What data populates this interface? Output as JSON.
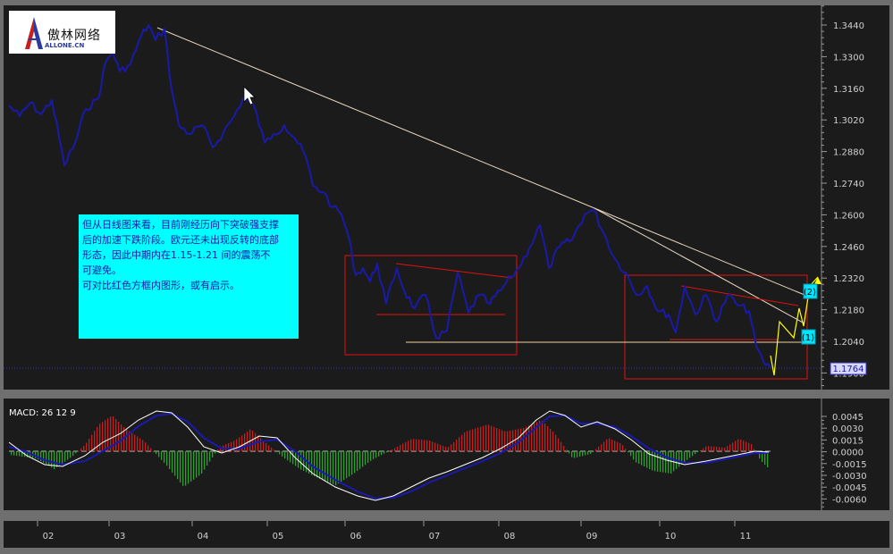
{
  "logo": {
    "name": "傲林网络",
    "domain": "ALLONE.CN"
  },
  "price_panel": {
    "y_ticks": [
      "1.3440",
      "1.3300",
      "1.3160",
      "1.3020",
      "1.2880",
      "1.2740",
      "1.2600",
      "1.2460",
      "1.2320",
      "1.2180",
      "1.2040",
      "1.1900"
    ],
    "last_price_label": "1.1764",
    "wave_labels": [
      "(2)",
      "(1)"
    ]
  },
  "annotation": {
    "lines": [
      "但从日线图来看，目前刚经历向下突破强支撑",
      "后的加速下跌阶段。欧元还未出现反转的底部",
      "形态，因此中期内在1.15-1.21  间的震荡不",
      "可避免。",
      "可对比红色方框内图形，或有启示。"
    ]
  },
  "macd_panel": {
    "label": "MACD: 26 12 9",
    "y_ticks": [
      "0.0045",
      "0.0030",
      "0.0015",
      "0.0000",
      "-0.0015",
      "-0.0030",
      "-0.0045",
      "-0.0060"
    ]
  },
  "x_axis": {
    "labels": [
      "02",
      "03",
      "04",
      "05",
      "06",
      "07",
      "08",
      "09",
      "10",
      "11"
    ]
  },
  "colors": {
    "background": "#1b1b1b",
    "price_line": "#1a1aa8",
    "trendline": "#e8d8c0",
    "box": "#e01010",
    "support": "#f0d0a0",
    "annotation_bg": "#00ffff",
    "projection": "#ffff00",
    "macd_pos": "#c81e1e",
    "macd_neg": "#2fa02f",
    "macd_line": "#ffffff",
    "signal_line": "#1a1ab0"
  },
  "chart_data": [
    {
      "type": "line",
      "title": "",
      "x": [
        "02",
        "03",
        "04",
        "05",
        "06",
        "07",
        "08",
        "09",
        "10",
        "11"
      ],
      "ylim": [
        1.175,
        1.35
      ],
      "series": [
        {
          "values": [
            1.305,
            1.336,
            1.312,
            1.305,
            1.228,
            1.194,
            1.23,
            1.254,
            1.205,
            1.21,
            1.178
          ]
        }
      ],
      "last_value": 1.1764
    },
    {
      "type": "bar",
      "title": "",
      "label": "MACD: 26 12 9",
      "ylim": [
        -0.0065,
        0.0055
      ],
      "x": [
        "02",
        "03",
        "04",
        "05",
        "06",
        "07",
        "08",
        "09",
        "10",
        "11"
      ]
    }
  ]
}
